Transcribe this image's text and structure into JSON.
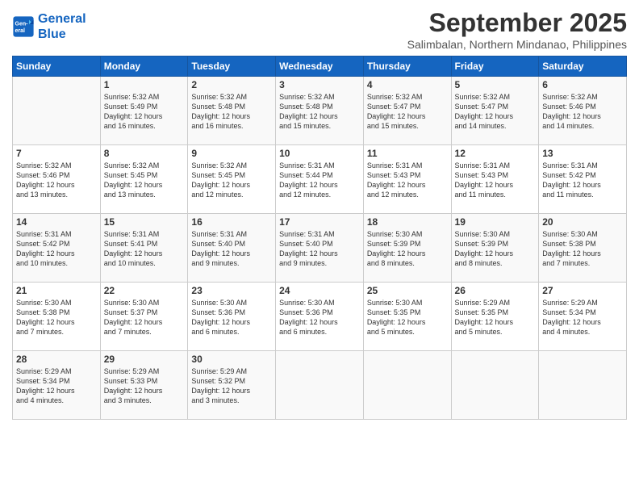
{
  "logo": {
    "line1": "General",
    "line2": "Blue"
  },
  "title": "September 2025",
  "location": "Salimbalan, Northern Mindanao, Philippines",
  "days_of_week": [
    "Sunday",
    "Monday",
    "Tuesday",
    "Wednesday",
    "Thursday",
    "Friday",
    "Saturday"
  ],
  "weeks": [
    [
      {
        "day": "",
        "text": ""
      },
      {
        "day": "1",
        "text": "Sunrise: 5:32 AM\nSunset: 5:49 PM\nDaylight: 12 hours\nand 16 minutes."
      },
      {
        "day": "2",
        "text": "Sunrise: 5:32 AM\nSunset: 5:48 PM\nDaylight: 12 hours\nand 16 minutes."
      },
      {
        "day": "3",
        "text": "Sunrise: 5:32 AM\nSunset: 5:48 PM\nDaylight: 12 hours\nand 15 minutes."
      },
      {
        "day": "4",
        "text": "Sunrise: 5:32 AM\nSunset: 5:47 PM\nDaylight: 12 hours\nand 15 minutes."
      },
      {
        "day": "5",
        "text": "Sunrise: 5:32 AM\nSunset: 5:47 PM\nDaylight: 12 hours\nand 14 minutes."
      },
      {
        "day": "6",
        "text": "Sunrise: 5:32 AM\nSunset: 5:46 PM\nDaylight: 12 hours\nand 14 minutes."
      }
    ],
    [
      {
        "day": "7",
        "text": "Sunrise: 5:32 AM\nSunset: 5:46 PM\nDaylight: 12 hours\nand 13 minutes."
      },
      {
        "day": "8",
        "text": "Sunrise: 5:32 AM\nSunset: 5:45 PM\nDaylight: 12 hours\nand 13 minutes."
      },
      {
        "day": "9",
        "text": "Sunrise: 5:32 AM\nSunset: 5:45 PM\nDaylight: 12 hours\nand 12 minutes."
      },
      {
        "day": "10",
        "text": "Sunrise: 5:31 AM\nSunset: 5:44 PM\nDaylight: 12 hours\nand 12 minutes."
      },
      {
        "day": "11",
        "text": "Sunrise: 5:31 AM\nSunset: 5:43 PM\nDaylight: 12 hours\nand 12 minutes."
      },
      {
        "day": "12",
        "text": "Sunrise: 5:31 AM\nSunset: 5:43 PM\nDaylight: 12 hours\nand 11 minutes."
      },
      {
        "day": "13",
        "text": "Sunrise: 5:31 AM\nSunset: 5:42 PM\nDaylight: 12 hours\nand 11 minutes."
      }
    ],
    [
      {
        "day": "14",
        "text": "Sunrise: 5:31 AM\nSunset: 5:42 PM\nDaylight: 12 hours\nand 10 minutes."
      },
      {
        "day": "15",
        "text": "Sunrise: 5:31 AM\nSunset: 5:41 PM\nDaylight: 12 hours\nand 10 minutes."
      },
      {
        "day": "16",
        "text": "Sunrise: 5:31 AM\nSunset: 5:40 PM\nDaylight: 12 hours\nand 9 minutes."
      },
      {
        "day": "17",
        "text": "Sunrise: 5:31 AM\nSunset: 5:40 PM\nDaylight: 12 hours\nand 9 minutes."
      },
      {
        "day": "18",
        "text": "Sunrise: 5:30 AM\nSunset: 5:39 PM\nDaylight: 12 hours\nand 8 minutes."
      },
      {
        "day": "19",
        "text": "Sunrise: 5:30 AM\nSunset: 5:39 PM\nDaylight: 12 hours\nand 8 minutes."
      },
      {
        "day": "20",
        "text": "Sunrise: 5:30 AM\nSunset: 5:38 PM\nDaylight: 12 hours\nand 7 minutes."
      }
    ],
    [
      {
        "day": "21",
        "text": "Sunrise: 5:30 AM\nSunset: 5:38 PM\nDaylight: 12 hours\nand 7 minutes."
      },
      {
        "day": "22",
        "text": "Sunrise: 5:30 AM\nSunset: 5:37 PM\nDaylight: 12 hours\nand 7 minutes."
      },
      {
        "day": "23",
        "text": "Sunrise: 5:30 AM\nSunset: 5:36 PM\nDaylight: 12 hours\nand 6 minutes."
      },
      {
        "day": "24",
        "text": "Sunrise: 5:30 AM\nSunset: 5:36 PM\nDaylight: 12 hours\nand 6 minutes."
      },
      {
        "day": "25",
        "text": "Sunrise: 5:30 AM\nSunset: 5:35 PM\nDaylight: 12 hours\nand 5 minutes."
      },
      {
        "day": "26",
        "text": "Sunrise: 5:29 AM\nSunset: 5:35 PM\nDaylight: 12 hours\nand 5 minutes."
      },
      {
        "day": "27",
        "text": "Sunrise: 5:29 AM\nSunset: 5:34 PM\nDaylight: 12 hours\nand 4 minutes."
      }
    ],
    [
      {
        "day": "28",
        "text": "Sunrise: 5:29 AM\nSunset: 5:34 PM\nDaylight: 12 hours\nand 4 minutes."
      },
      {
        "day": "29",
        "text": "Sunrise: 5:29 AM\nSunset: 5:33 PM\nDaylight: 12 hours\nand 3 minutes."
      },
      {
        "day": "30",
        "text": "Sunrise: 5:29 AM\nSunset: 5:32 PM\nDaylight: 12 hours\nand 3 minutes."
      },
      {
        "day": "",
        "text": ""
      },
      {
        "day": "",
        "text": ""
      },
      {
        "day": "",
        "text": ""
      },
      {
        "day": "",
        "text": ""
      }
    ]
  ]
}
